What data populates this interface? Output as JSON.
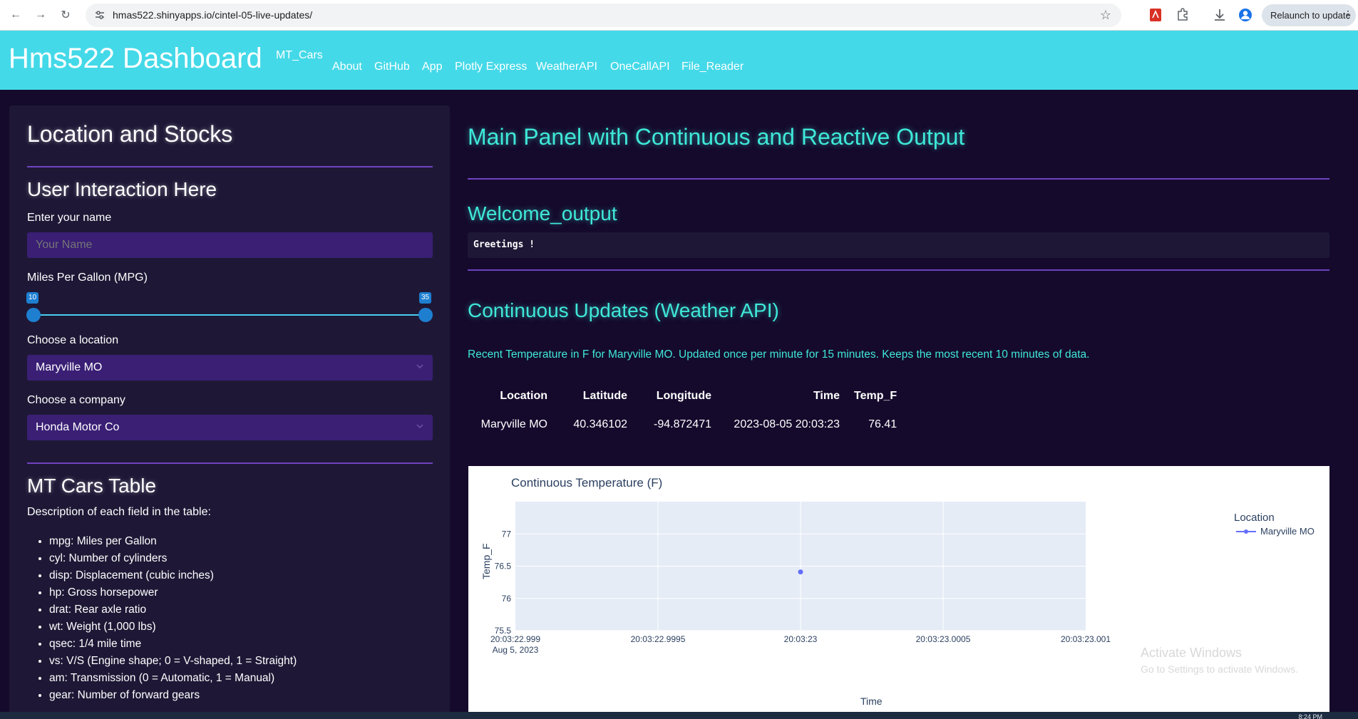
{
  "browser": {
    "url": "hmas522.shinyapps.io/cintel-05-live-updates/",
    "relaunch_label": "Relaunch to update"
  },
  "navbar": {
    "brand": "Hms522 Dashboard",
    "links": [
      "MT_Cars",
      "About",
      "GitHub",
      "App",
      "Plotly Express",
      "WeatherAPI",
      "OneCallAPI",
      "File_Reader"
    ]
  },
  "sidebar": {
    "title": "Location and Stocks",
    "interaction_title": "User Interaction Here",
    "name_label": "Enter your name",
    "name_placeholder": "Your Name",
    "mpg_label": "Miles Per Gallon (MPG)",
    "mpg_min": "10",
    "mpg_max": "35",
    "location_label": "Choose a location",
    "location_value": "Maryville MO",
    "company_label": "Choose a company",
    "company_value": "Honda Motor Co",
    "mtcars_title": "MT Cars Table",
    "mtcars_desc": "Description of each field in the table:",
    "fields": [
      "mpg: Miles per Gallon",
      "cyl: Number of cylinders",
      "disp: Displacement (cubic inches)",
      "hp: Gross horsepower",
      "drat: Rear axle ratio",
      "wt: Weight (1,000 lbs)",
      "qsec: 1/4 mile time",
      "vs: V/S (Engine shape; 0 = V-shaped, 1 = Straight)",
      "am: Transmission (0 = Automatic, 1 = Manual)",
      "gear: Number of forward gears"
    ]
  },
  "main": {
    "title": "Main Panel with Continuous and Reactive Output",
    "welcome_title": "Welcome_output",
    "greeting": "Greetings !",
    "continuous_title": "Continuous Updates (Weather API)",
    "note": "Recent Temperature in F for Maryville MO. Updated once per minute for 15 minutes. Keeps the most recent 10 minutes of data.",
    "table": {
      "headers": [
        "Location",
        "Latitude",
        "Longitude",
        "Time",
        "Temp_F"
      ],
      "rows": [
        [
          "Maryville MO",
          "40.346102",
          "-94.872471",
          "2023-08-05 20:03:23",
          "76.41"
        ]
      ]
    }
  },
  "chart_data": {
    "type": "scatter",
    "title": "Continuous Temperature (F)",
    "xlabel": "Time",
    "ylabel": "Temp_F",
    "x_ticks": [
      "20:03:22.999",
      "20:03:22.9995",
      "20:03:23",
      "20:03:23.0005",
      "20:03:23.001"
    ],
    "x_tick_sub": "Aug 5, 2023",
    "y_ticks": [
      75.5,
      76,
      76.5,
      77
    ],
    "ylim": [
      75.5,
      77.5
    ],
    "legend_title": "Location",
    "series": [
      {
        "name": "Maryville MO",
        "color": "#636efa",
        "points": [
          {
            "x": "2023-08-05 20:03:23",
            "y": 76.41
          }
        ]
      }
    ]
  },
  "watermark": {
    "line1": "Activate Windows",
    "line2": "Go to Settings to activate Windows."
  },
  "taskbar": {
    "clock": "8:24 PM"
  }
}
